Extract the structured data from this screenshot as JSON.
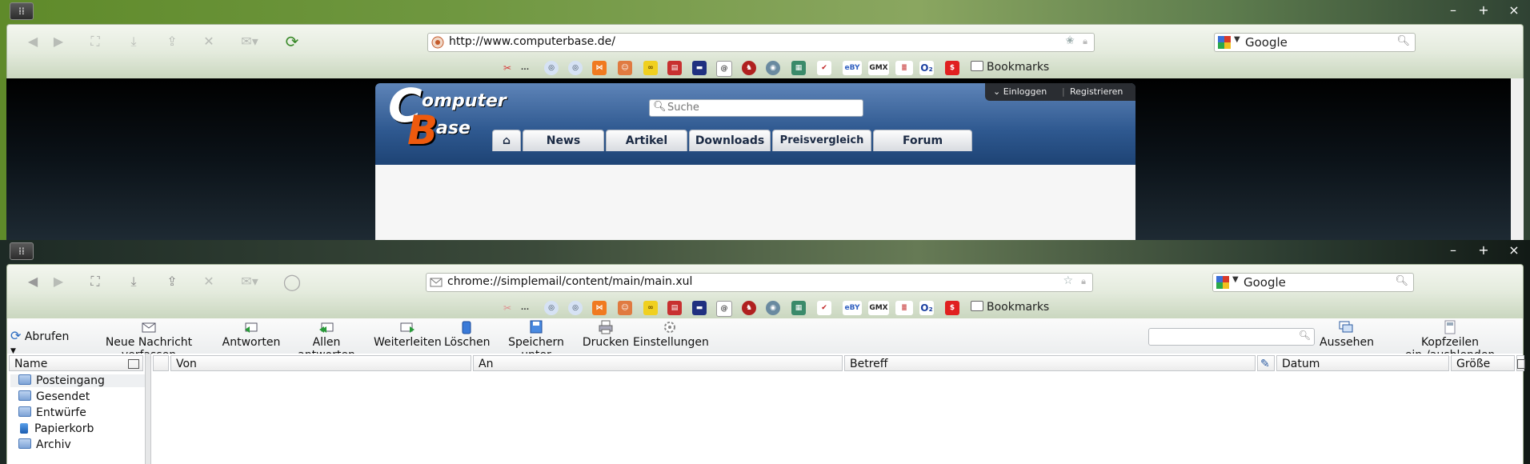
{
  "window1": {
    "url": "http://www.computerbase.de/",
    "search_engine": "Google",
    "bookmarks_label": "Bookmarks",
    "bm_more": "...",
    "page": {
      "search_placeholder": "Suche",
      "login": "Einloggen",
      "register": "Registrieren",
      "tabs": [
        "News",
        "Artikel",
        "Downloads",
        "Preisvergleich",
        "Forum"
      ]
    }
  },
  "window2": {
    "url": "chrome://simplemail/content/main/main.xul",
    "search_engine": "Google",
    "bookmarks_label": "Bookmarks",
    "bm_more": "...",
    "toolbar": {
      "fetch": "Abrufen",
      "new_message": "Neue Nachricht verfassen",
      "reply": "Antworten",
      "reply_all": "Allen antworten",
      "forward": "Weiterleiten",
      "delete": "Löschen",
      "save_as": "Speichern unter",
      "print": "Drucken",
      "settings": "Einstellungen",
      "appearance": "Aussehen",
      "toggle_headers": "Kopfzeilen ein-/ausblenden"
    },
    "folder_column": "Name",
    "folders": [
      "Posteingang",
      "Gesendet",
      "Entwürfe",
      "Papierkorb",
      "Archiv"
    ],
    "columns": {
      "from": "Von",
      "to": "An",
      "subject": "Betreff",
      "date": "Datum",
      "size": "Größe"
    }
  },
  "window_controls": {
    "minimize": "–",
    "maximize": "+",
    "close": "×"
  },
  "colors": {
    "accent_green": "#6f9740",
    "cb_blue": "#2f5990",
    "cb_orange": "#ee5a0e"
  }
}
